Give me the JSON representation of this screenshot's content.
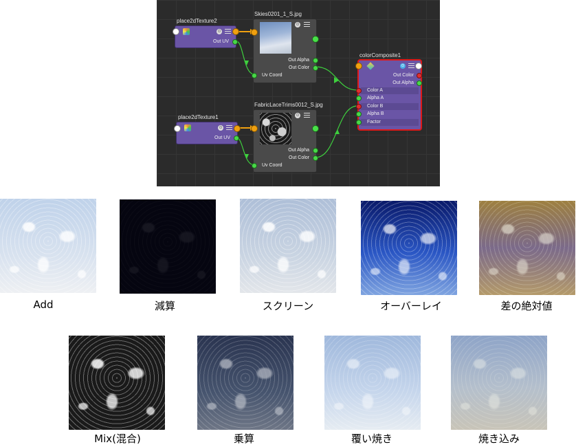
{
  "graph": {
    "nodes": {
      "place2d2": {
        "title": "place2dTexture2",
        "out_uv": "Out UV"
      },
      "skies": {
        "title": "Skies0201_1_S.jpg",
        "out_alpha": "Out Alpha",
        "out_color": "Out Color",
        "uv_coord": "Uv Coord"
      },
      "place2d1": {
        "title": "place2dTexture1",
        "out_uv": "Out UV"
      },
      "fabric": {
        "title": "FabricLaceTrims0012_S.jpg",
        "out_alpha": "Out Alpha",
        "out_color": "Out Color",
        "uv_coord": "Uv Coord"
      },
      "composite": {
        "title": "colorComposite1",
        "out_color": "Out Color",
        "out_alpha": "Out Alpha",
        "inputs": [
          "Color A",
          "Alpha A",
          "Color B",
          "Alpha B",
          "Factor"
        ]
      }
    },
    "colors": {
      "wire_green": "#3ecf3e",
      "wire_orange": "#f0a010",
      "selection_red": "#e01818",
      "node_purple": "#6a55a6"
    }
  },
  "results": [
    {
      "label": "Add"
    },
    {
      "label": "減算"
    },
    {
      "label": "スクリーン"
    },
    {
      "label": "オーバーレイ"
    },
    {
      "label": "差の絶対値"
    },
    {
      "label": "Mix(混合)"
    },
    {
      "label": "乗算"
    },
    {
      "label": "覆い焼き"
    },
    {
      "label": "焼き込み"
    }
  ]
}
